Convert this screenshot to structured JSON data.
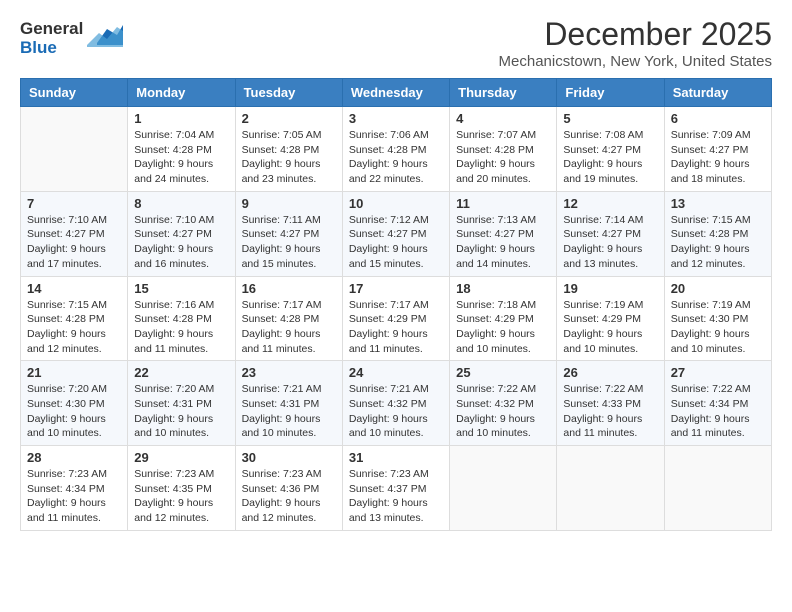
{
  "header": {
    "logo_line1": "General",
    "logo_line2": "Blue",
    "title": "December 2025",
    "subtitle": "Mechanicstown, New York, United States"
  },
  "days_of_week": [
    "Sunday",
    "Monday",
    "Tuesday",
    "Wednesday",
    "Thursday",
    "Friday",
    "Saturday"
  ],
  "weeks": [
    [
      {
        "day": "",
        "sunrise": "",
        "sunset": "",
        "daylight": ""
      },
      {
        "day": "1",
        "sunrise": "7:04 AM",
        "sunset": "4:28 PM",
        "daylight": "9 hours and 24 minutes."
      },
      {
        "day": "2",
        "sunrise": "7:05 AM",
        "sunset": "4:28 PM",
        "daylight": "9 hours and 23 minutes."
      },
      {
        "day": "3",
        "sunrise": "7:06 AM",
        "sunset": "4:28 PM",
        "daylight": "9 hours and 22 minutes."
      },
      {
        "day": "4",
        "sunrise": "7:07 AM",
        "sunset": "4:28 PM",
        "daylight": "9 hours and 20 minutes."
      },
      {
        "day": "5",
        "sunrise": "7:08 AM",
        "sunset": "4:27 PM",
        "daylight": "9 hours and 19 minutes."
      },
      {
        "day": "6",
        "sunrise": "7:09 AM",
        "sunset": "4:27 PM",
        "daylight": "9 hours and 18 minutes."
      }
    ],
    [
      {
        "day": "7",
        "sunrise": "7:10 AM",
        "sunset": "4:27 PM",
        "daylight": "9 hours and 17 minutes."
      },
      {
        "day": "8",
        "sunrise": "7:10 AM",
        "sunset": "4:27 PM",
        "daylight": "9 hours and 16 minutes."
      },
      {
        "day": "9",
        "sunrise": "7:11 AM",
        "sunset": "4:27 PM",
        "daylight": "9 hours and 15 minutes."
      },
      {
        "day": "10",
        "sunrise": "7:12 AM",
        "sunset": "4:27 PM",
        "daylight": "9 hours and 15 minutes."
      },
      {
        "day": "11",
        "sunrise": "7:13 AM",
        "sunset": "4:27 PM",
        "daylight": "9 hours and 14 minutes."
      },
      {
        "day": "12",
        "sunrise": "7:14 AM",
        "sunset": "4:27 PM",
        "daylight": "9 hours and 13 minutes."
      },
      {
        "day": "13",
        "sunrise": "7:15 AM",
        "sunset": "4:28 PM",
        "daylight": "9 hours and 12 minutes."
      }
    ],
    [
      {
        "day": "14",
        "sunrise": "7:15 AM",
        "sunset": "4:28 PM",
        "daylight": "9 hours and 12 minutes."
      },
      {
        "day": "15",
        "sunrise": "7:16 AM",
        "sunset": "4:28 PM",
        "daylight": "9 hours and 11 minutes."
      },
      {
        "day": "16",
        "sunrise": "7:17 AM",
        "sunset": "4:28 PM",
        "daylight": "9 hours and 11 minutes."
      },
      {
        "day": "17",
        "sunrise": "7:17 AM",
        "sunset": "4:29 PM",
        "daylight": "9 hours and 11 minutes."
      },
      {
        "day": "18",
        "sunrise": "7:18 AM",
        "sunset": "4:29 PM",
        "daylight": "9 hours and 10 minutes."
      },
      {
        "day": "19",
        "sunrise": "7:19 AM",
        "sunset": "4:29 PM",
        "daylight": "9 hours and 10 minutes."
      },
      {
        "day": "20",
        "sunrise": "7:19 AM",
        "sunset": "4:30 PM",
        "daylight": "9 hours and 10 minutes."
      }
    ],
    [
      {
        "day": "21",
        "sunrise": "7:20 AM",
        "sunset": "4:30 PM",
        "daylight": "9 hours and 10 minutes."
      },
      {
        "day": "22",
        "sunrise": "7:20 AM",
        "sunset": "4:31 PM",
        "daylight": "9 hours and 10 minutes."
      },
      {
        "day": "23",
        "sunrise": "7:21 AM",
        "sunset": "4:31 PM",
        "daylight": "9 hours and 10 minutes."
      },
      {
        "day": "24",
        "sunrise": "7:21 AM",
        "sunset": "4:32 PM",
        "daylight": "9 hours and 10 minutes."
      },
      {
        "day": "25",
        "sunrise": "7:22 AM",
        "sunset": "4:32 PM",
        "daylight": "9 hours and 10 minutes."
      },
      {
        "day": "26",
        "sunrise": "7:22 AM",
        "sunset": "4:33 PM",
        "daylight": "9 hours and 11 minutes."
      },
      {
        "day": "27",
        "sunrise": "7:22 AM",
        "sunset": "4:34 PM",
        "daylight": "9 hours and 11 minutes."
      }
    ],
    [
      {
        "day": "28",
        "sunrise": "7:23 AM",
        "sunset": "4:34 PM",
        "daylight": "9 hours and 11 minutes."
      },
      {
        "day": "29",
        "sunrise": "7:23 AM",
        "sunset": "4:35 PM",
        "daylight": "9 hours and 12 minutes."
      },
      {
        "day": "30",
        "sunrise": "7:23 AM",
        "sunset": "4:36 PM",
        "daylight": "9 hours and 12 minutes."
      },
      {
        "day": "31",
        "sunrise": "7:23 AM",
        "sunset": "4:37 PM",
        "daylight": "9 hours and 13 minutes."
      },
      {
        "day": "",
        "sunrise": "",
        "sunset": "",
        "daylight": ""
      },
      {
        "day": "",
        "sunrise": "",
        "sunset": "",
        "daylight": ""
      },
      {
        "day": "",
        "sunrise": "",
        "sunset": "",
        "daylight": ""
      }
    ]
  ],
  "labels": {
    "sunrise_prefix": "Sunrise: ",
    "sunset_prefix": "Sunset: ",
    "daylight_prefix": "Daylight: "
  }
}
